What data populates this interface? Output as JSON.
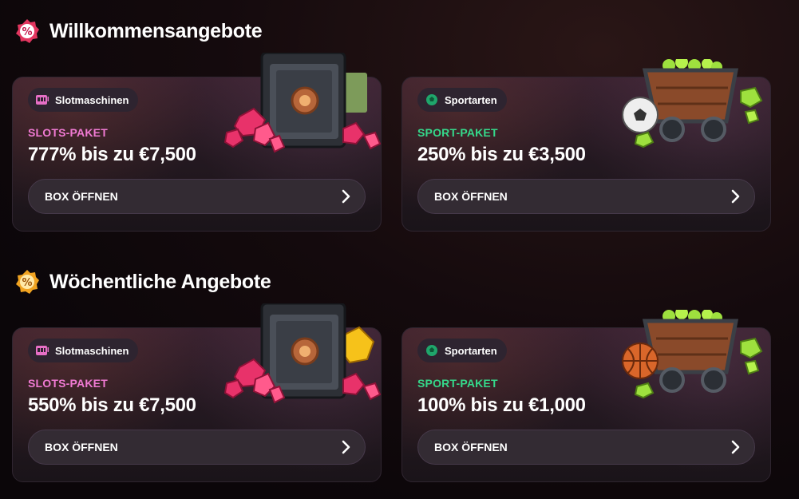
{
  "sections": [
    {
      "title": "Willkommensangebote",
      "icon": "percent-badge-pink-icon",
      "cards": [
        {
          "chip": "Slotmaschinen",
          "chip_icon": "slot-machine-icon",
          "package": "SLOTS-PAKET",
          "offer": "777% bis zu €7,500",
          "button": "BOX ÖFFNEN",
          "art": "safe-with-gems-and-cash"
        },
        {
          "chip": "Sportarten",
          "chip_icon": "sports-icon",
          "package": "SPORT-PAKET",
          "offer": "250% bis zu €3,500",
          "button": "BOX ÖFFNEN",
          "art": "mine-cart-with-football"
        }
      ]
    },
    {
      "title": "Wöchentliche Angebote",
      "icon": "percent-badge-gold-icon",
      "cards": [
        {
          "chip": "Slotmaschinen",
          "chip_icon": "slot-machine-icon",
          "package": "SLOTS-PAKET",
          "offer": "550% bis zu €7,500",
          "button": "BOX ÖFFNEN",
          "art": "safe-with-gems-and-gold"
        },
        {
          "chip": "Sportarten",
          "chip_icon": "sports-icon",
          "package": "SPORT-PAKET",
          "offer": "100% bis zu €1,000",
          "button": "BOX ÖFFNEN",
          "art": "mine-cart-with-basketball"
        }
      ]
    }
  ],
  "colors": {
    "slots_accent": "#f07ad3",
    "sport_accent": "#35d98b",
    "button_bg": "#332b33",
    "card_bg": "#231820"
  }
}
